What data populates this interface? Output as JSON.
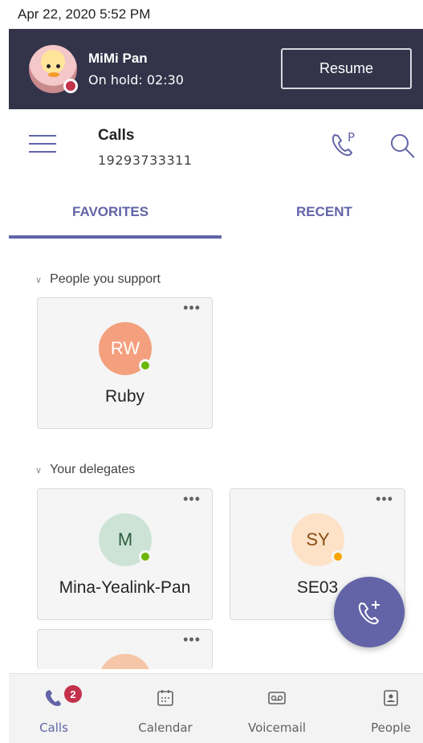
{
  "status_bar": {
    "datetime": "Apr 22, 2020  5:52 PM"
  },
  "hold_banner": {
    "caller_name": "MiMi Pan",
    "hold_status": "On hold: 02:30",
    "resume_label": "Resume",
    "presence_color": "#c4314b"
  },
  "header": {
    "title": "Calls",
    "phone_number": "19293733311",
    "park_icon": "call-park-icon",
    "search_icon": "search-icon",
    "menu_icon": "hamburger-menu-icon"
  },
  "tabs": [
    {
      "label": "FAVORITES",
      "selected": true
    },
    {
      "label": "RECENT",
      "selected": false
    }
  ],
  "sections": [
    {
      "title": "People you support",
      "cards": [
        {
          "initials": "RW",
          "name": "Ruby",
          "avatar_bg": "#f4a07f",
          "avatar_fg": "#ffffff",
          "presence": "available",
          "presence_color": "#6bb700"
        }
      ]
    },
    {
      "title": "Your delegates",
      "cards": [
        {
          "initials": "M",
          "name": "Mina-Yealink-Pan",
          "avatar_bg": "#cde3d6",
          "avatar_fg": "#2b5e3e",
          "presence": "available",
          "presence_color": "#6bb700"
        },
        {
          "initials": "SY",
          "name": "SE03",
          "avatar_bg": "#fde2c8",
          "avatar_fg": "#8a4d13",
          "presence": "away",
          "presence_color": "#f8a500"
        }
      ]
    }
  ],
  "card_more_label": "•••",
  "fab": {
    "icon": "new-call-icon"
  },
  "bottom_nav": [
    {
      "label": "Calls",
      "icon": "calls-icon",
      "active": true,
      "badge": "2"
    },
    {
      "label": "Calendar",
      "icon": "calendar-icon",
      "active": false
    },
    {
      "label": "Voicemail",
      "icon": "voicemail-icon",
      "active": false
    },
    {
      "label": "People",
      "icon": "people-icon",
      "active": false
    }
  ],
  "colors": {
    "accent": "#6264a7",
    "hold_bar": "#33344a",
    "alert": "#c4314b"
  }
}
